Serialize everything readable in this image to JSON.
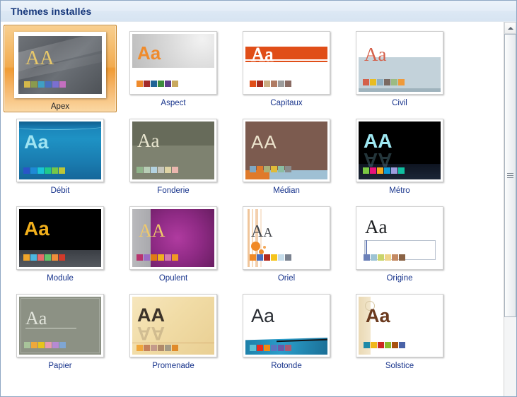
{
  "window": {
    "title": "Thèmes installés"
  },
  "scrollbar": {
    "up_arrow_name": "scroll-up-arrow-icon",
    "thumb_name": "scrollbar-thumb"
  },
  "gallery": {
    "selected_theme": "Apex",
    "columns": 4,
    "rows": [
      [
        "Apex",
        "Aspect",
        "Capitaux",
        "Civil"
      ],
      [
        "Débit",
        "Fonderie",
        "Médian",
        "Métro"
      ],
      [
        "Module",
        "Opulent",
        "Oriel",
        "Origine"
      ],
      [
        "Papier",
        "Promenade",
        "Rotonde",
        "Solstice"
      ]
    ],
    "themes": [
      {
        "name": "Apex",
        "selected": true,
        "sample_text": "AA",
        "swatches": [
          "#d5b84a",
          "#8a9a4e",
          "#3f9fc4",
          "#4a6fbf",
          "#7b6fd1",
          "#c46fc0"
        ]
      },
      {
        "name": "Aspect",
        "selected": false,
        "sample_text": "Aa",
        "swatches": [
          "#ef8b2c",
          "#a32a2a",
          "#1f6496",
          "#3d8c3d",
          "#5f3d8c",
          "#c9a95e"
        ]
      },
      {
        "name": "Capitaux",
        "selected": false,
        "sample_text": "Aa",
        "swatches": [
          "#e04e18",
          "#a62a1e",
          "#c9ae84",
          "#b07c64",
          "#9c9c9c",
          "#8a6b63"
        ]
      },
      {
        "name": "Civil",
        "selected": false,
        "sample_text": "Aa",
        "swatches": [
          "#d4604a",
          "#e8bc22",
          "#8fb0c2",
          "#7a6a62",
          "#9cbb83",
          "#ef9a3a"
        ]
      },
      {
        "name": "Débit",
        "selected": false,
        "sample_text": "Aa",
        "swatches": [
          "#2a55c8",
          "#1e8ad6",
          "#19c4d6",
          "#1fc98a",
          "#74c648",
          "#bcc637"
        ]
      },
      {
        "name": "Fonderie",
        "selected": false,
        "sample_text": "Aa",
        "swatches": [
          "#8fb48a",
          "#b8ceb6",
          "#b3d2e0",
          "#c5c5bb",
          "#ded3a3",
          "#eab6ae"
        ]
      },
      {
        "name": "Médian",
        "selected": false,
        "sample_text": "AA",
        "swatches": [
          "#7fa7c4",
          "#e07a2a",
          "#a8b07a",
          "#e0bb38",
          "#8bbda2",
          "#8a8a8a"
        ]
      },
      {
        "name": "Métro",
        "selected": false,
        "sample_text": "AA",
        "swatches": [
          "#7ac943",
          "#e8127a",
          "#f5a81c",
          "#0d9bd6",
          "#9d9ddd",
          "#10bfa0"
        ]
      },
      {
        "name": "Module",
        "selected": false,
        "sample_text": "Aa",
        "swatches": [
          "#f0a52a",
          "#4cb6e0",
          "#e86a6a",
          "#63c46a",
          "#ef8f3a",
          "#d13a2a"
        ]
      },
      {
        "name": "Opulent",
        "selected": false,
        "sample_text": "AA",
        "swatches": [
          "#b8336e",
          "#9b6bc4",
          "#e07a14",
          "#efb01e",
          "#d47aae",
          "#f09a22"
        ]
      },
      {
        "name": "Oriel",
        "selected": false,
        "sample_text": "Aa",
        "swatches": [
          "#f08a28",
          "#4a6fbf",
          "#b32a1e",
          "#f5c41c",
          "#c5dcea",
          "#7a8290"
        ]
      },
      {
        "name": "Origine",
        "selected": false,
        "sample_text": "Aa",
        "swatches": [
          "#6b80b8",
          "#9dc3d4",
          "#c9d46b",
          "#efd48a",
          "#c48a63",
          "#8a6345"
        ]
      },
      {
        "name": "Papier",
        "selected": false,
        "sample_text": "Aa",
        "swatches": [
          "#a8c49a",
          "#efa83a",
          "#e8c41c",
          "#e89ab0",
          "#b68ad4",
          "#7fa6d4"
        ]
      },
      {
        "name": "Promenade",
        "selected": false,
        "sample_text": "AA",
        "swatches": [
          "#f0a63a",
          "#c4805a",
          "#c49a8a",
          "#b08a6a",
          "#a39a85",
          "#e08a2a"
        ]
      },
      {
        "name": "Rotonde",
        "selected": false,
        "sample_text": "Aa",
        "swatches": [
          "#5ec2d4",
          "#e82a1e",
          "#f08a14",
          "#5a74bf",
          "#6a5aa8",
          "#a85a74"
        ]
      },
      {
        "name": "Solstice",
        "selected": false,
        "sample_text": "Aa",
        "swatches": [
          "#1f8aa8",
          "#f0b81c",
          "#cc2a22",
          "#8abb2a",
          "#a8520f",
          "#4a63a8"
        ]
      }
    ]
  }
}
